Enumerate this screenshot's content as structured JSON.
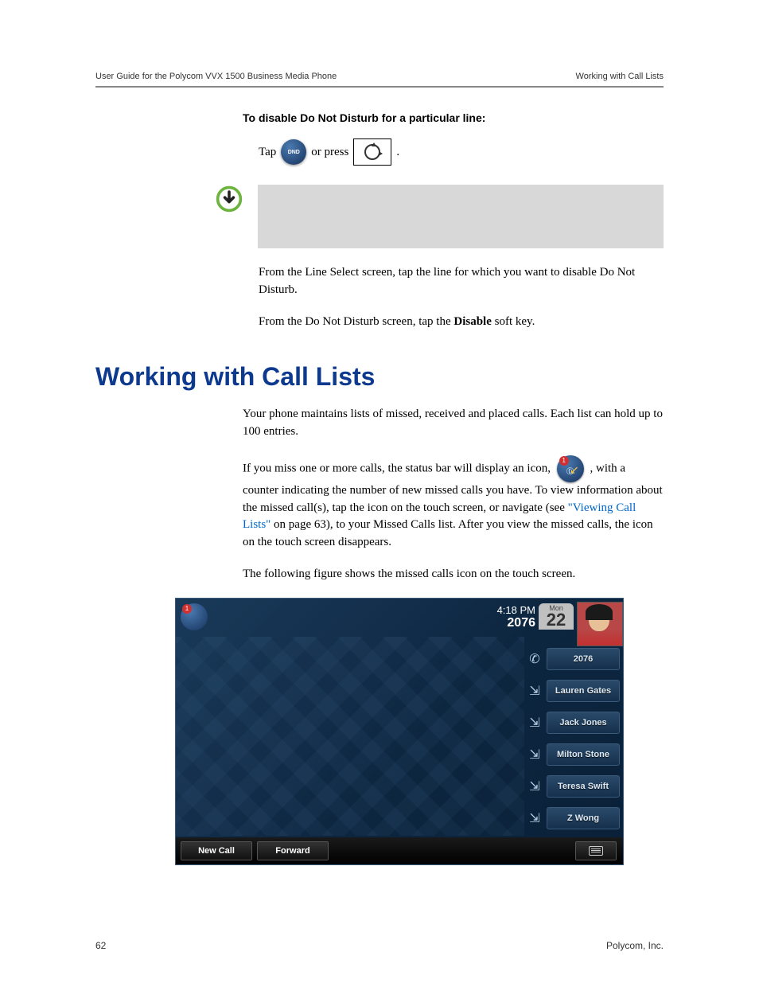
{
  "header": {
    "left": "User Guide for the Polycom VVX 1500 Business Media Phone",
    "right": "Working with Call Lists"
  },
  "section1": {
    "heading": "To disable Do Not Disturb for a particular line:",
    "tap": "Tap",
    "or_press": "or press",
    "period": ".",
    "dnd_icon_name": "DND",
    "para1_a": "From the Line Select screen, tap the line for which you want to disable Do Not Disturb.",
    "para2_a": "From the Do Not Disturb screen, tap the ",
    "para2_bold": "Disable",
    "para2_b": " soft key."
  },
  "section2": {
    "title": "Working with Call Lists",
    "para1": "Your phone maintains lists of missed, received and placed calls. Each list can hold up to 100 entries.",
    "para2_a": "If you miss one or more calls, the status bar will display an icon, ",
    "para2_b": " , with a counter indicating the number of new missed calls you have. To view information about the missed call(s), tap the icon on the touch screen, or navigate (see ",
    "link": "\"Viewing Call Lists\"",
    "para2_c": " on page 63), to your Missed Calls list. After you view the missed calls, the icon on the touch screen disappears.",
    "para3": "The following figure shows the missed calls icon on the touch screen.",
    "missed_badge": "1"
  },
  "phone": {
    "missed_badge": "1",
    "time": "4:18 PM",
    "ext": "2076",
    "day_name": "Mon",
    "day_num": "22",
    "contacts": [
      {
        "label": "2076",
        "icon": "handset"
      },
      {
        "label": "Lauren Gates",
        "icon": "speed-dial"
      },
      {
        "label": "Jack Jones",
        "icon": "speed-dial"
      },
      {
        "label": "Milton Stone",
        "icon": "speed-dial"
      },
      {
        "label": "Teresa Swift",
        "icon": "speed-dial"
      },
      {
        "label": "Z Wong",
        "icon": "speed-dial"
      }
    ],
    "softkeys": {
      "new_call": "New Call",
      "forward": "Forward"
    }
  },
  "footer": {
    "page": "62",
    "company": "Polycom, Inc."
  }
}
